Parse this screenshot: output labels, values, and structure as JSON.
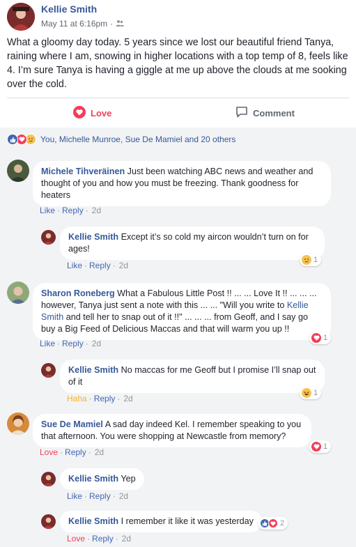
{
  "post": {
    "author": "Kellie Smith",
    "timestamp": "May 11 at 6:16pm",
    "meta_separator": "·",
    "text": "What a gloomy day today. 5 years since we lost our beautiful friend Tanya, raining where I am, snowing in higher locations with a top temp of 8, feels like 4. I’m sure Tanya is having a giggle at me up above the clouds at me sooking over the cold.",
    "love_label": "Love",
    "comment_label": "Comment"
  },
  "reactions": {
    "summary": "You, Michelle Munroe, Sue De Mamiel and 20 others",
    "icons": [
      "like-icon",
      "love-icon",
      "sad-icon"
    ]
  },
  "comments": [
    {
      "name": "Michele Tihveräinen",
      "text": "Just been watching ABC news and weather and thought of you and how you must be freezing. Thank goodness for heaters",
      "like": "Like",
      "reply": "Reply",
      "time": "2d"
    },
    {
      "name": "Kellie Smith",
      "text": "Except it’s so cold my aircon wouldn’t turn on for ages!",
      "like": "Like",
      "reply": "Reply",
      "time": "2d",
      "reaction_count": "1"
    },
    {
      "name": "Sharon Roneberg",
      "text_a": "What a Fabulous Little Post !! ... ... Love It !! ... ... ... however, Tanya just sent a note with this ... ... \"Will you write to",
      "link": "Kellie Smith",
      "text_b": "and tell her to snap out of it !!\" ... ... ... from Geoff, and I say go buy a Big Feed of Delicious Maccas and that will warm you up !!",
      "like": "Like",
      "reply": "Reply",
      "time": "2d",
      "reaction_count": "1"
    },
    {
      "name": "Kellie Smith",
      "text": "No maccas for me Geoff but I promise I’ll snap out of it",
      "like": "Haha",
      "reply": "Reply",
      "time": "2d",
      "reaction_count": "1"
    },
    {
      "name": "Sue De Mamiel",
      "text": "A sad day indeed Kel. I remember speaking to you that afternoon. You were shopping at Newcastle from memory?",
      "like": "Love",
      "reply": "Reply",
      "time": "2d",
      "reaction_count": "1"
    },
    {
      "name": "Kellie Smith",
      "text": "Yep",
      "like": "Like",
      "reply": "Reply",
      "time": "2d"
    },
    {
      "name": "Kellie Smith",
      "text": "I remember it like it was yesterday",
      "like": "Love",
      "reply": "Reply",
      "time": "2d",
      "reaction_count": "2"
    }
  ],
  "colors": {
    "link_blue": "#365899",
    "love_red": "#f33e58",
    "like_blue": "#4267b2",
    "haha_yellow": "#f7b125",
    "gray_bg": "#f2f3f5"
  }
}
